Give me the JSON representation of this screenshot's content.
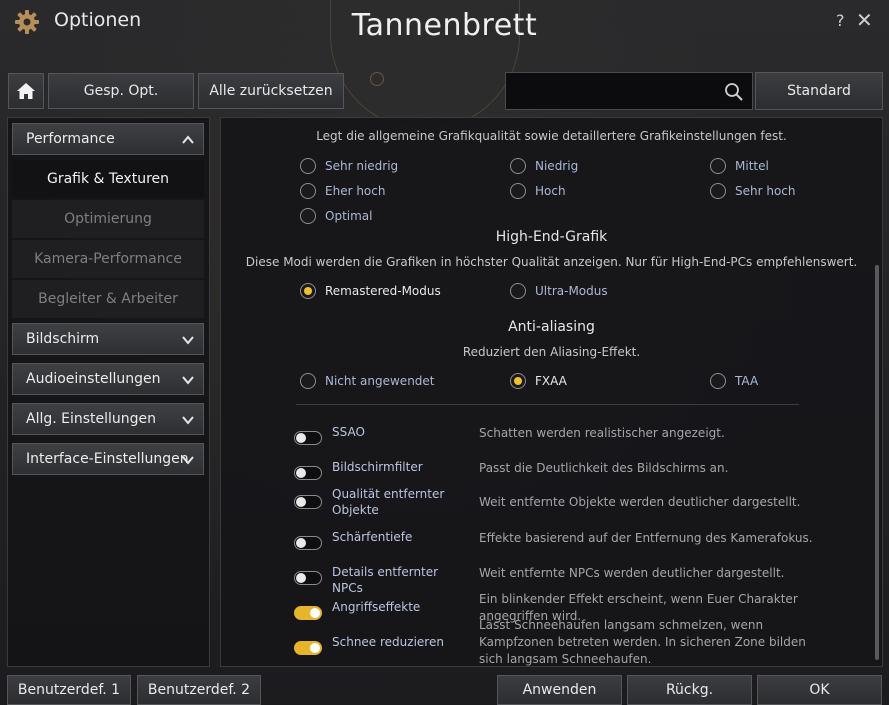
{
  "window": {
    "title": "Optionen",
    "center_title": "Tannenbrett",
    "help_glyph": "?",
    "close_glyph": "✕",
    "icons": [
      "gear-icon",
      "help-icon",
      "close-icon",
      "home-icon",
      "search-icon",
      "chevron-up-icon",
      "chevron-down-icon"
    ]
  },
  "toolbar": {
    "gesp_label": "Gesp. Opt.",
    "reset_label": "Alle zurücksetzen",
    "search_placeholder": "",
    "standard_label": "Standard"
  },
  "sidebar": {
    "categories": [
      {
        "label": "Performance",
        "expanded": true
      },
      {
        "label": "Bildschirm",
        "expanded": false
      },
      {
        "label": "Audioeinstellungen",
        "expanded": false
      },
      {
        "label": "Allg. Einstellungen",
        "expanded": false
      },
      {
        "label": "Interface-Einstellungen",
        "expanded": false
      }
    ],
    "subitems": [
      {
        "label": "Grafik & Texturen",
        "active": true
      },
      {
        "label": "Optimierung",
        "active": false
      },
      {
        "label": "Kamera-Performance",
        "active": false
      },
      {
        "label": "Begleiter & Arbeiter",
        "active": false
      }
    ]
  },
  "content": {
    "quality_desc": "Legt die allgemeine Grafikqualität sowie detaillertere Grafikeinstellungen fest.",
    "quality_options": [
      {
        "label": "Sehr niedrig",
        "selected": false
      },
      {
        "label": "Niedrig",
        "selected": false
      },
      {
        "label": "Mittel",
        "selected": false
      },
      {
        "label": "Eher hoch",
        "selected": false
      },
      {
        "label": "Hoch",
        "selected": false
      },
      {
        "label": "Sehr hoch",
        "selected": false
      },
      {
        "label": "Optimal",
        "selected": false
      }
    ],
    "highend": {
      "title": "High-End-Grafik",
      "desc": "Diese Modi werden die Grafiken in höchster Qualität anzeigen. Nur für High-End-PCs empfehlenswert.",
      "options": [
        {
          "label": "Remastered-Modus",
          "selected": true
        },
        {
          "label": "Ultra-Modus",
          "selected": false
        }
      ]
    },
    "aa": {
      "title": "Anti-aliasing",
      "desc": "Reduziert den Aliasing-Effekt.",
      "options": [
        {
          "label": "Nicht angewendet",
          "selected": false
        },
        {
          "label": "FXAA",
          "selected": true
        },
        {
          "label": "TAA",
          "selected": false
        }
      ]
    },
    "toggles": [
      {
        "name": "SSAO",
        "desc": "Schatten werden realistischer angezeigt.",
        "on": false
      },
      {
        "name": "Bildschirmfilter",
        "desc": "Passt die Deutlichkeit des Bildschirms an.",
        "on": false
      },
      {
        "name": "Qualität entfernter Objekte",
        "desc": "Weit entfernte Objekte werden deutlicher dargestellt.",
        "on": false
      },
      {
        "name": "Schärfentiefe",
        "desc": "Effekte basierend auf der Entfernung des Kamerafokus.",
        "on": false
      },
      {
        "name": "Details entfernter NPCs",
        "desc": "Weit entfernte NPCs werden deutlicher dargestellt.",
        "on": false
      },
      {
        "name": "Angriffseffekte",
        "desc": "Ein blinkender Effekt erscheint, wenn Euer Charakter angegriffen wird.",
        "on": true
      },
      {
        "name": "Schnee reduzieren",
        "desc": "Lässt Schneehaufen langsam schmelzen, wenn Kampfzonen betreten werden. In sicheren Zone bilden sich langsam Schneehaufen.",
        "on": true
      }
    ]
  },
  "footer": {
    "user1": "Benutzerdef. 1",
    "user2": "Benutzerdef. 2",
    "apply": "Anwenden",
    "back": "Rückg.",
    "ok": "OK"
  },
  "colors": {
    "accent": "#f3c12a",
    "option_text": "#aab8d4",
    "panel_bg": "#16161a"
  }
}
